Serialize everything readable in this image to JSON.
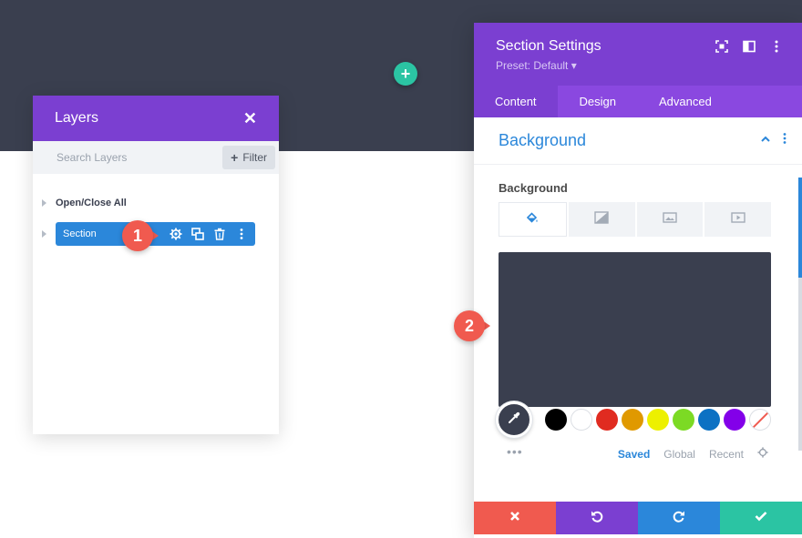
{
  "layers": {
    "title": "Layers",
    "search_placeholder": "Search Layers",
    "filter_label": "Filter",
    "open_close_label": "Open/Close All",
    "section_label": "Section"
  },
  "settings": {
    "title": "Section Settings",
    "preset": "Preset: Default",
    "tabs": [
      "Content",
      "Design",
      "Advanced"
    ],
    "toggle_title": "Background",
    "field_label": "Background",
    "preview_color": "#3a3f4f",
    "swatch_colors": [
      "#000000",
      "#ffffff",
      "#e02b20",
      "#e09900",
      "#edf000",
      "#7cda24",
      "#0c71c3",
      "#8300e9"
    ],
    "palette_tabs": [
      "Saved",
      "Global",
      "Recent"
    ]
  },
  "callouts": {
    "one": "1",
    "two": "2"
  },
  "colors": {
    "purple": "#7b3fd1",
    "purple_tab": "#8a48e0",
    "blue": "#2b87da",
    "teal": "#2bc4a3",
    "red": "#f05a4f",
    "dark": "#3a3f4f"
  }
}
